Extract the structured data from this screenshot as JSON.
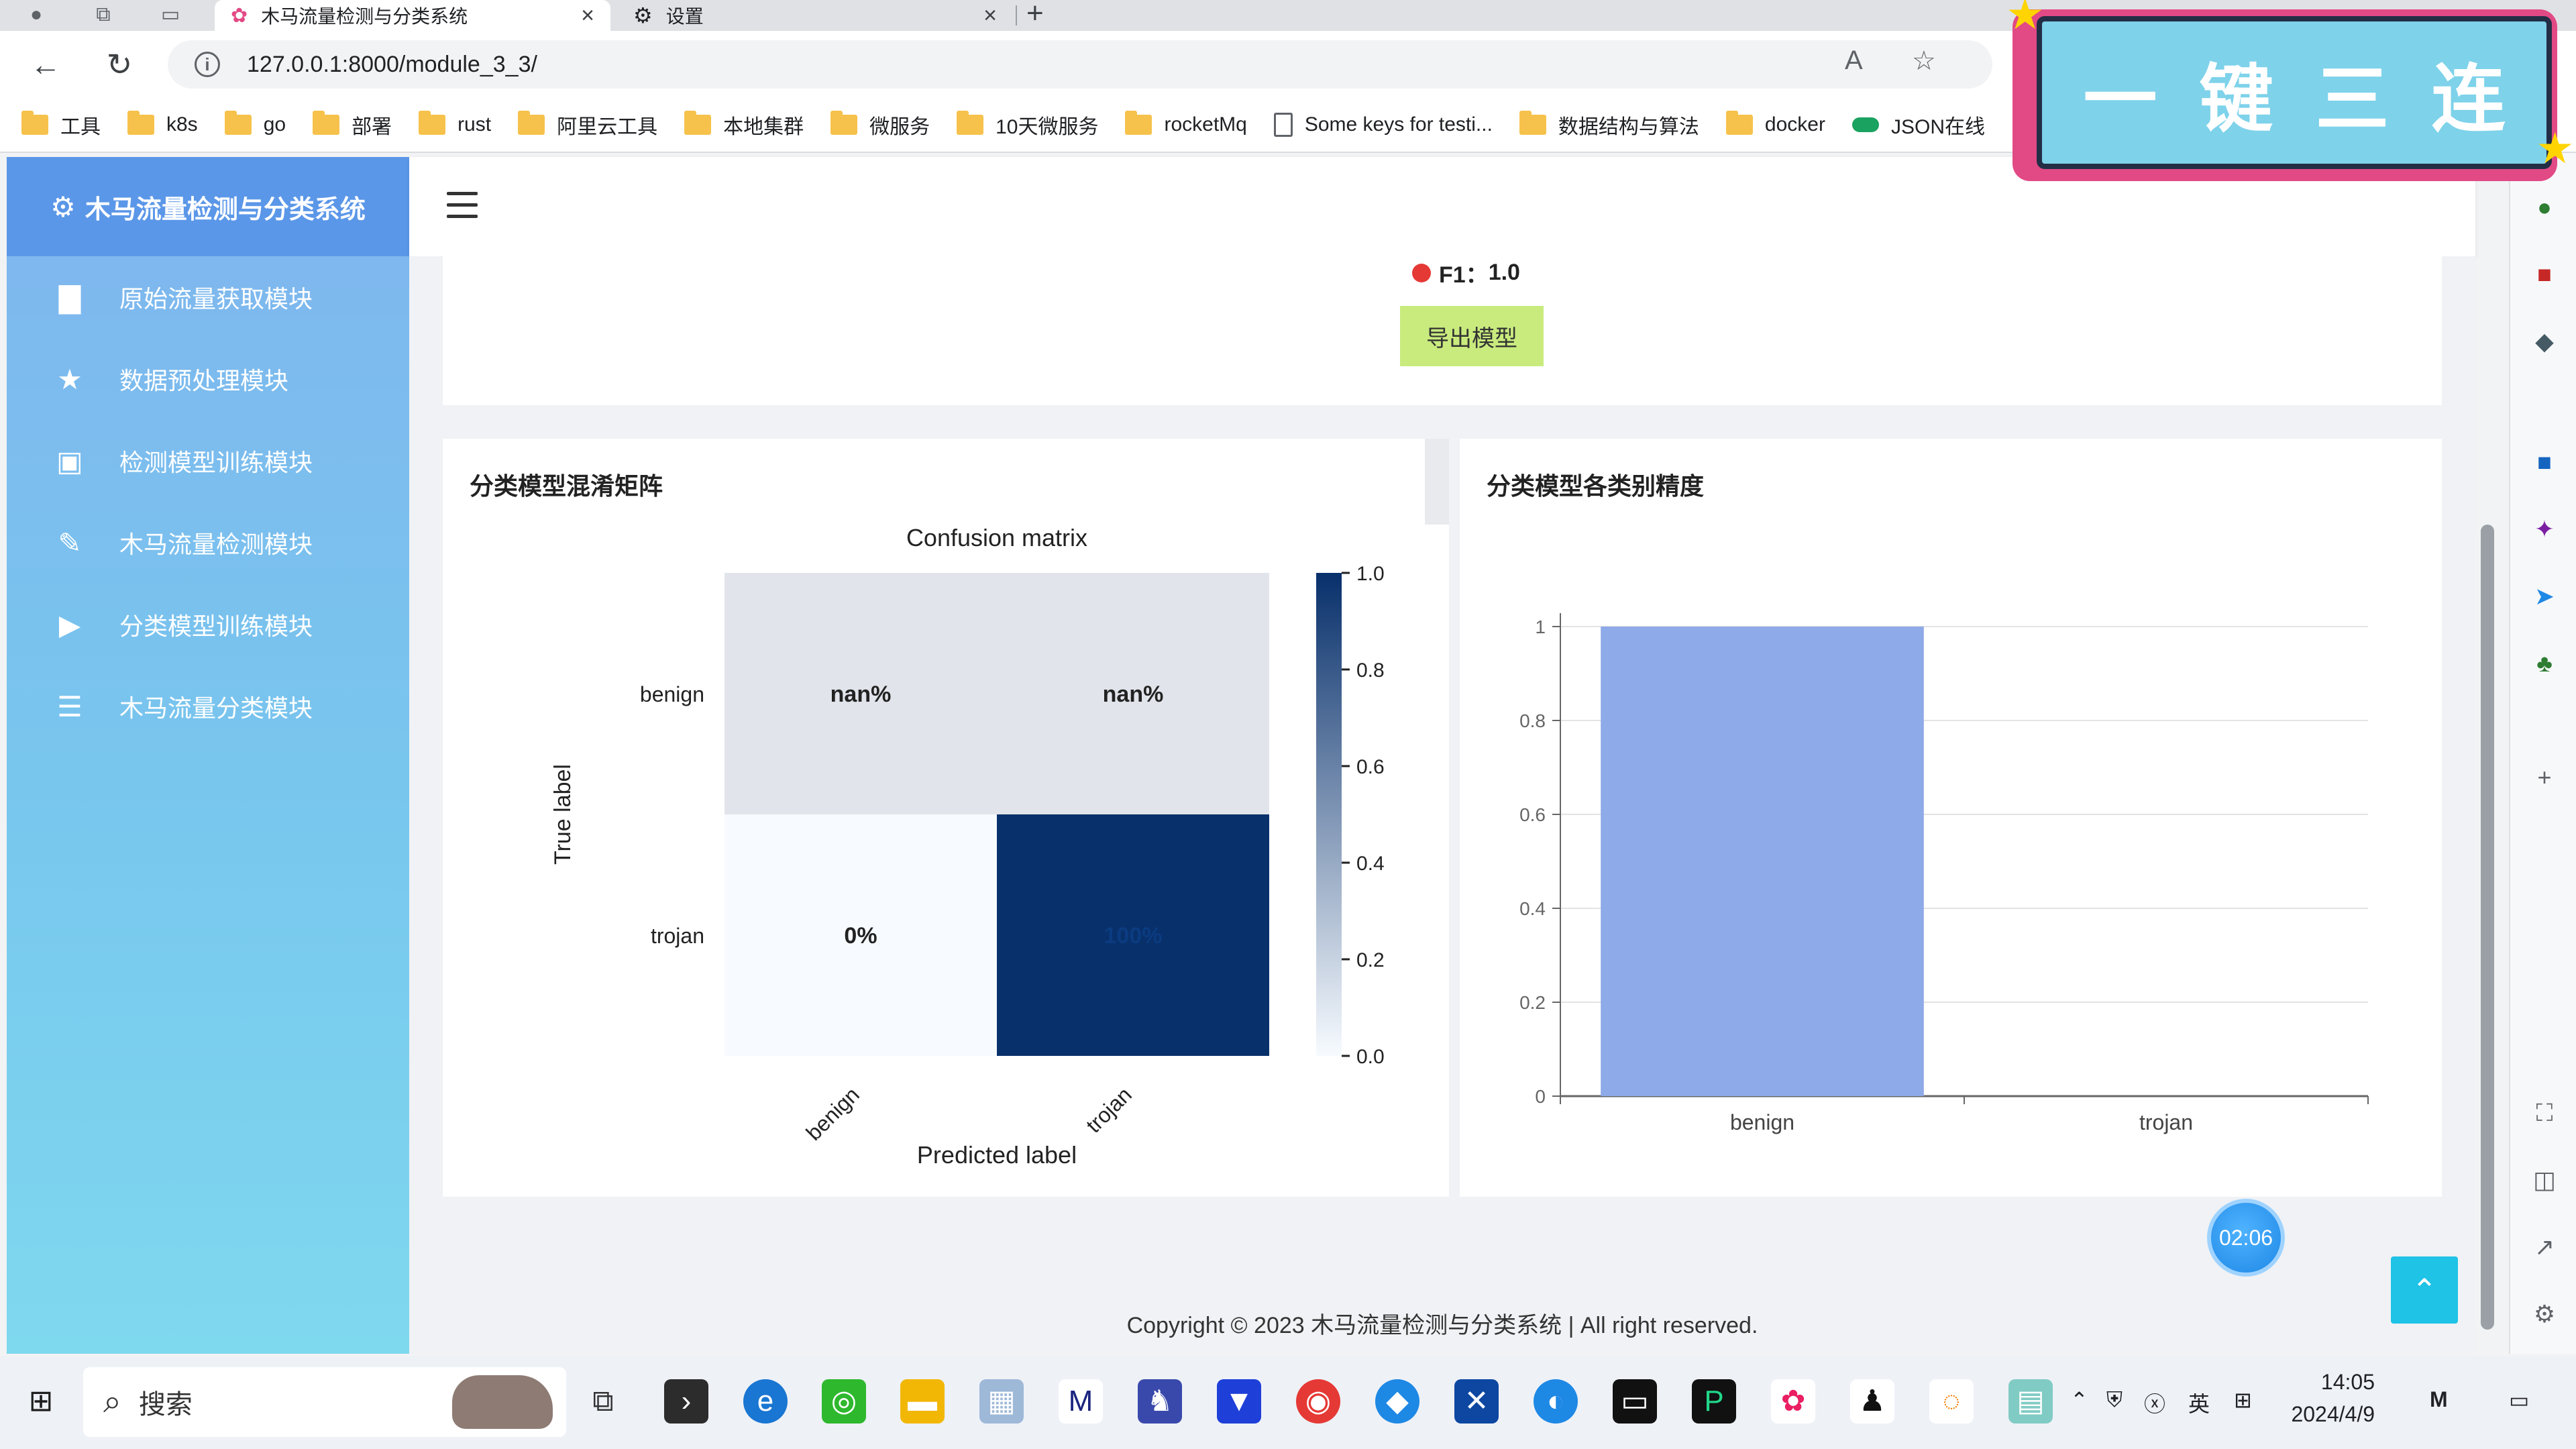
{
  "browser": {
    "tabs": [
      {
        "title": "木马流量检测与分类系统",
        "active": true
      },
      {
        "title": "设置",
        "active": false
      }
    ],
    "url": "127.0.0.1:8000/module_3_3/",
    "bookmarks": [
      {
        "label": "工具",
        "type": "folder"
      },
      {
        "label": "k8s",
        "type": "folder"
      },
      {
        "label": "go",
        "type": "folder"
      },
      {
        "label": "部署",
        "type": "folder"
      },
      {
        "label": "rust",
        "type": "folder"
      },
      {
        "label": "阿里云工具",
        "type": "folder"
      },
      {
        "label": "本地集群",
        "type": "folder"
      },
      {
        "label": "微服务",
        "type": "folder"
      },
      {
        "label": "10天微服务",
        "type": "folder"
      },
      {
        "label": "rocketMq",
        "type": "folder"
      },
      {
        "label": "Some keys for testi...",
        "type": "page"
      },
      {
        "label": "数据结构与算法",
        "type": "folder"
      },
      {
        "label": "docker",
        "type": "folder"
      },
      {
        "label": "JSON在线",
        "type": "json"
      }
    ]
  },
  "sidebar": {
    "title": "木马流量检测与分类系统",
    "items": [
      {
        "label": "原始流量获取模块",
        "icon": "file-icon",
        "glyph": "▇"
      },
      {
        "label": "数据预处理模块",
        "icon": "star-icon",
        "glyph": "★"
      },
      {
        "label": "检测模型训练模块",
        "icon": "play-square-icon",
        "glyph": "▣"
      },
      {
        "label": "木马流量检测模块",
        "icon": "edit-icon",
        "glyph": "✎"
      },
      {
        "label": "分类模型训练模块",
        "icon": "play-icon",
        "glyph": "▶"
      },
      {
        "label": "木马流量分类模块",
        "icon": "list-icon",
        "glyph": "☰"
      }
    ]
  },
  "metrics": {
    "f1_label": "F1：",
    "f1_value": "1.0"
  },
  "export_button": "导出模型",
  "confusion_card": {
    "title": "分类模型混淆矩阵"
  },
  "accuracy_card": {
    "title": "分类模型各类别精度"
  },
  "chart_data": [
    {
      "type": "heatmap",
      "title": "Confusion matrix",
      "xlabel": "Predicted label",
      "ylabel": "True label",
      "x_categories": [
        "benign",
        "trojan"
      ],
      "y_categories": [
        "benign",
        "trojan"
      ],
      "values": [
        [
          null,
          null
        ],
        [
          0.0,
          1.0
        ]
      ],
      "cell_labels": [
        [
          "nan%",
          "nan%"
        ],
        [
          "0%",
          "100%"
        ]
      ],
      "colorbar": {
        "min": 0.0,
        "max": 1.0,
        "ticks": [
          "0.0",
          "0.2",
          "0.4",
          "0.6",
          "0.8",
          "1.0"
        ]
      },
      "colors": {
        "low": "#f7fbff",
        "high": "#08306b",
        "nan": "#e1e4ea"
      }
    },
    {
      "type": "bar",
      "categories": [
        "benign",
        "trojan"
      ],
      "values": [
        1.0,
        0.0
      ],
      "ylim": [
        0,
        1
      ],
      "yticks": [
        "0",
        "0.2",
        "0.4",
        "0.6",
        "0.8",
        "1"
      ],
      "bar_color": "#8faae8",
      "grid": true
    }
  ],
  "footer": "Copyright © 2023 木马流量检测与分类系统 | All right reserved.",
  "timer": "02:06",
  "overlay_banner": [
    "一",
    "键",
    "三",
    "连"
  ],
  "taskbar": {
    "search_placeholder": "搜索",
    "ime": "英",
    "time": "14:05",
    "date": "2024/4/9"
  }
}
